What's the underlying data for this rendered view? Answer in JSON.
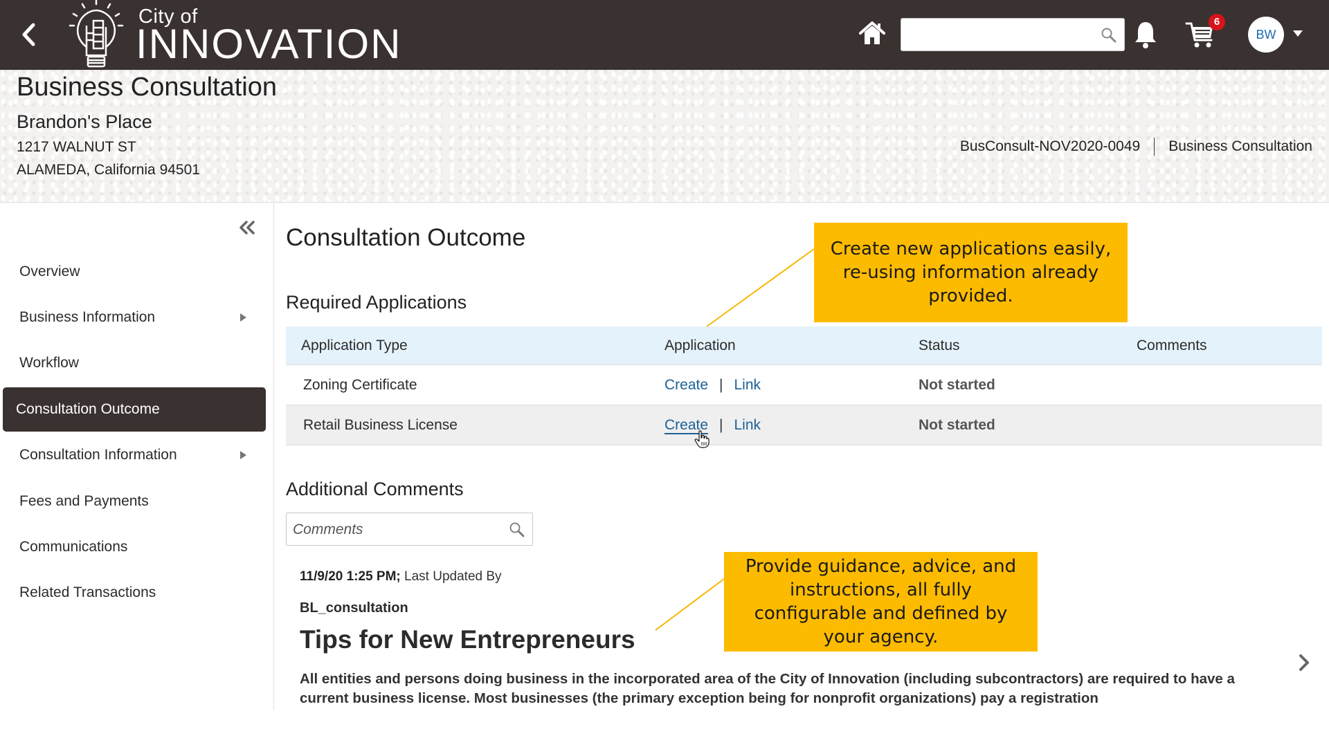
{
  "header": {
    "logo_line1": "City of",
    "logo_line2": "INNOVATION",
    "search_placeholder": "",
    "cart_count": "6",
    "user_initials": "BW",
    "icons": [
      "back-chevron-icon",
      "lightbulb-logo-icon",
      "home-icon",
      "search-icon",
      "bell-icon",
      "cart-icon",
      "caret-down-icon"
    ]
  },
  "subheader": {
    "page_title": "Business Consultation",
    "business_name": "Brandon's Place",
    "address_line1": "1217 WALNUT ST",
    "address_line2": "ALAMEDA, California 94501",
    "reference_id": "BusConsult-NOV2020-0049",
    "reference_type": "Business Consultation"
  },
  "sidebar": {
    "collapse_label": "«",
    "items": [
      {
        "label": "Overview",
        "has_submenu": false,
        "active": false
      },
      {
        "label": "Business Information",
        "has_submenu": true,
        "active": false
      },
      {
        "label": "Workflow",
        "has_submenu": false,
        "active": false
      },
      {
        "label": "Consultation Outcome",
        "has_submenu": false,
        "active": true
      },
      {
        "label": "Consultation Information",
        "has_submenu": true,
        "active": false
      },
      {
        "label": "Fees and Payments",
        "has_submenu": false,
        "active": false
      },
      {
        "label": "Communications",
        "has_submenu": false,
        "active": false
      },
      {
        "label": "Related Transactions",
        "has_submenu": false,
        "active": false
      }
    ]
  },
  "main": {
    "section_title": "Consultation Outcome",
    "required_title": "Required Applications",
    "table": {
      "headers": [
        "Application Type",
        "Application",
        "Status",
        "Comments"
      ],
      "rows": [
        {
          "type": "Zoning Certificate",
          "create": "Create",
          "sep": "|",
          "link": "Link",
          "status": "Not started",
          "comments": ""
        },
        {
          "type": "Retail Business License",
          "create": "Create",
          "sep": "|",
          "link": "Link",
          "status": "Not started",
          "comments": ""
        }
      ]
    },
    "additional_title": "Additional Comments",
    "comments_placeholder": "Comments",
    "comment": {
      "timestamp": "11/9/20 1:25 PM;",
      "updated_by_label": "Last Updated By",
      "author": "BL_consultation",
      "title": "Tips for New Entrepreneurs",
      "body": "All entities and persons doing business in the incorporated area of the City of Innovation (including subcontractors) are required to have a current business license. Most businesses (the primary exception being for nonprofit organizations) pay a registration"
    }
  },
  "callouts": [
    {
      "text": "Create new applications easily, re-using information already provided."
    },
    {
      "text": "Provide guidance, advice, and instructions, all fully configurable and defined by your agency."
    }
  ],
  "colors": {
    "topbar": "#3a3230",
    "accent_link": "#1b6098",
    "table_header": "#e4f2fb",
    "callout": "#fdbb00",
    "badge": "#d8131b"
  }
}
